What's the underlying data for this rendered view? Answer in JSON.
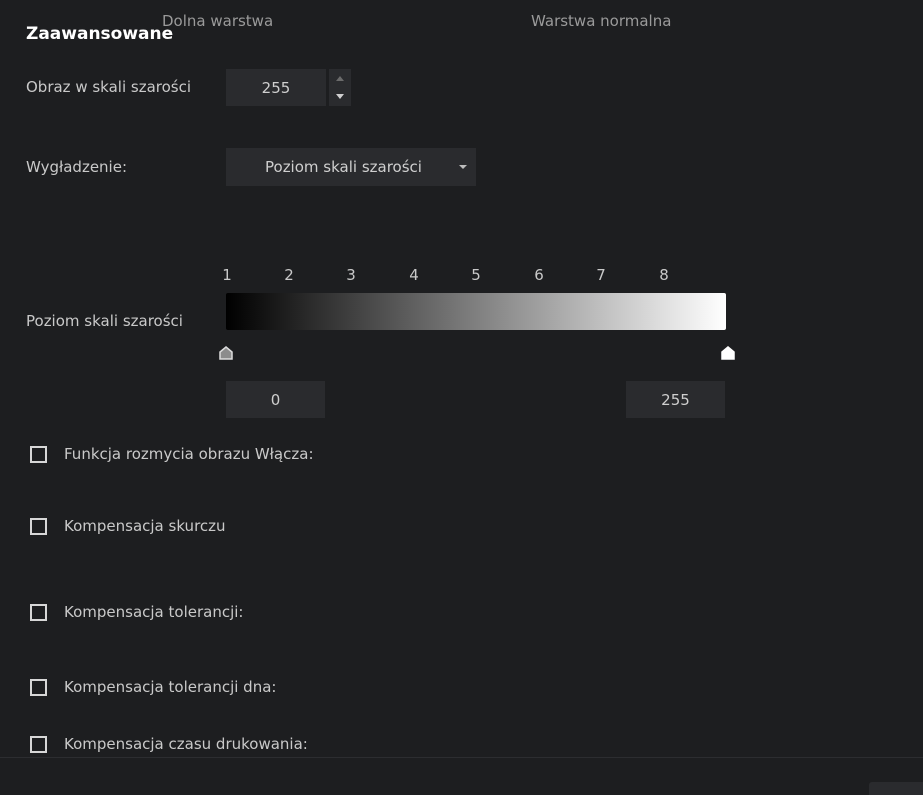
{
  "header": {
    "ghost_left": "Dolna warstwa",
    "ghost_right": "Warstwa normalna",
    "section_title": "Zaawansowane"
  },
  "grayscale_image": {
    "label": "Obraz w skali szarości",
    "value": "255"
  },
  "smoothing": {
    "label": "Wygładzenie:",
    "selected": "Poziom skali szarości"
  },
  "grayscale_level": {
    "label": "Poziom skali szarości",
    "ticks": [
      "1",
      "2",
      "3",
      "4",
      "5",
      "6",
      "7",
      "8"
    ],
    "min_value": "0",
    "max_value": "255"
  },
  "checkboxes": [
    {
      "label": "Funkcja rozmycia obrazu Włącza:",
      "checked": false
    },
    {
      "label": "Kompensacja skurczu",
      "checked": false
    },
    {
      "label": "Kompensacja tolerancji:",
      "checked": false
    },
    {
      "label": "Kompensacja tolerancji dna:",
      "checked": false
    },
    {
      "label": "Kompensacja czasu drukowania:",
      "checked": false
    }
  ]
}
